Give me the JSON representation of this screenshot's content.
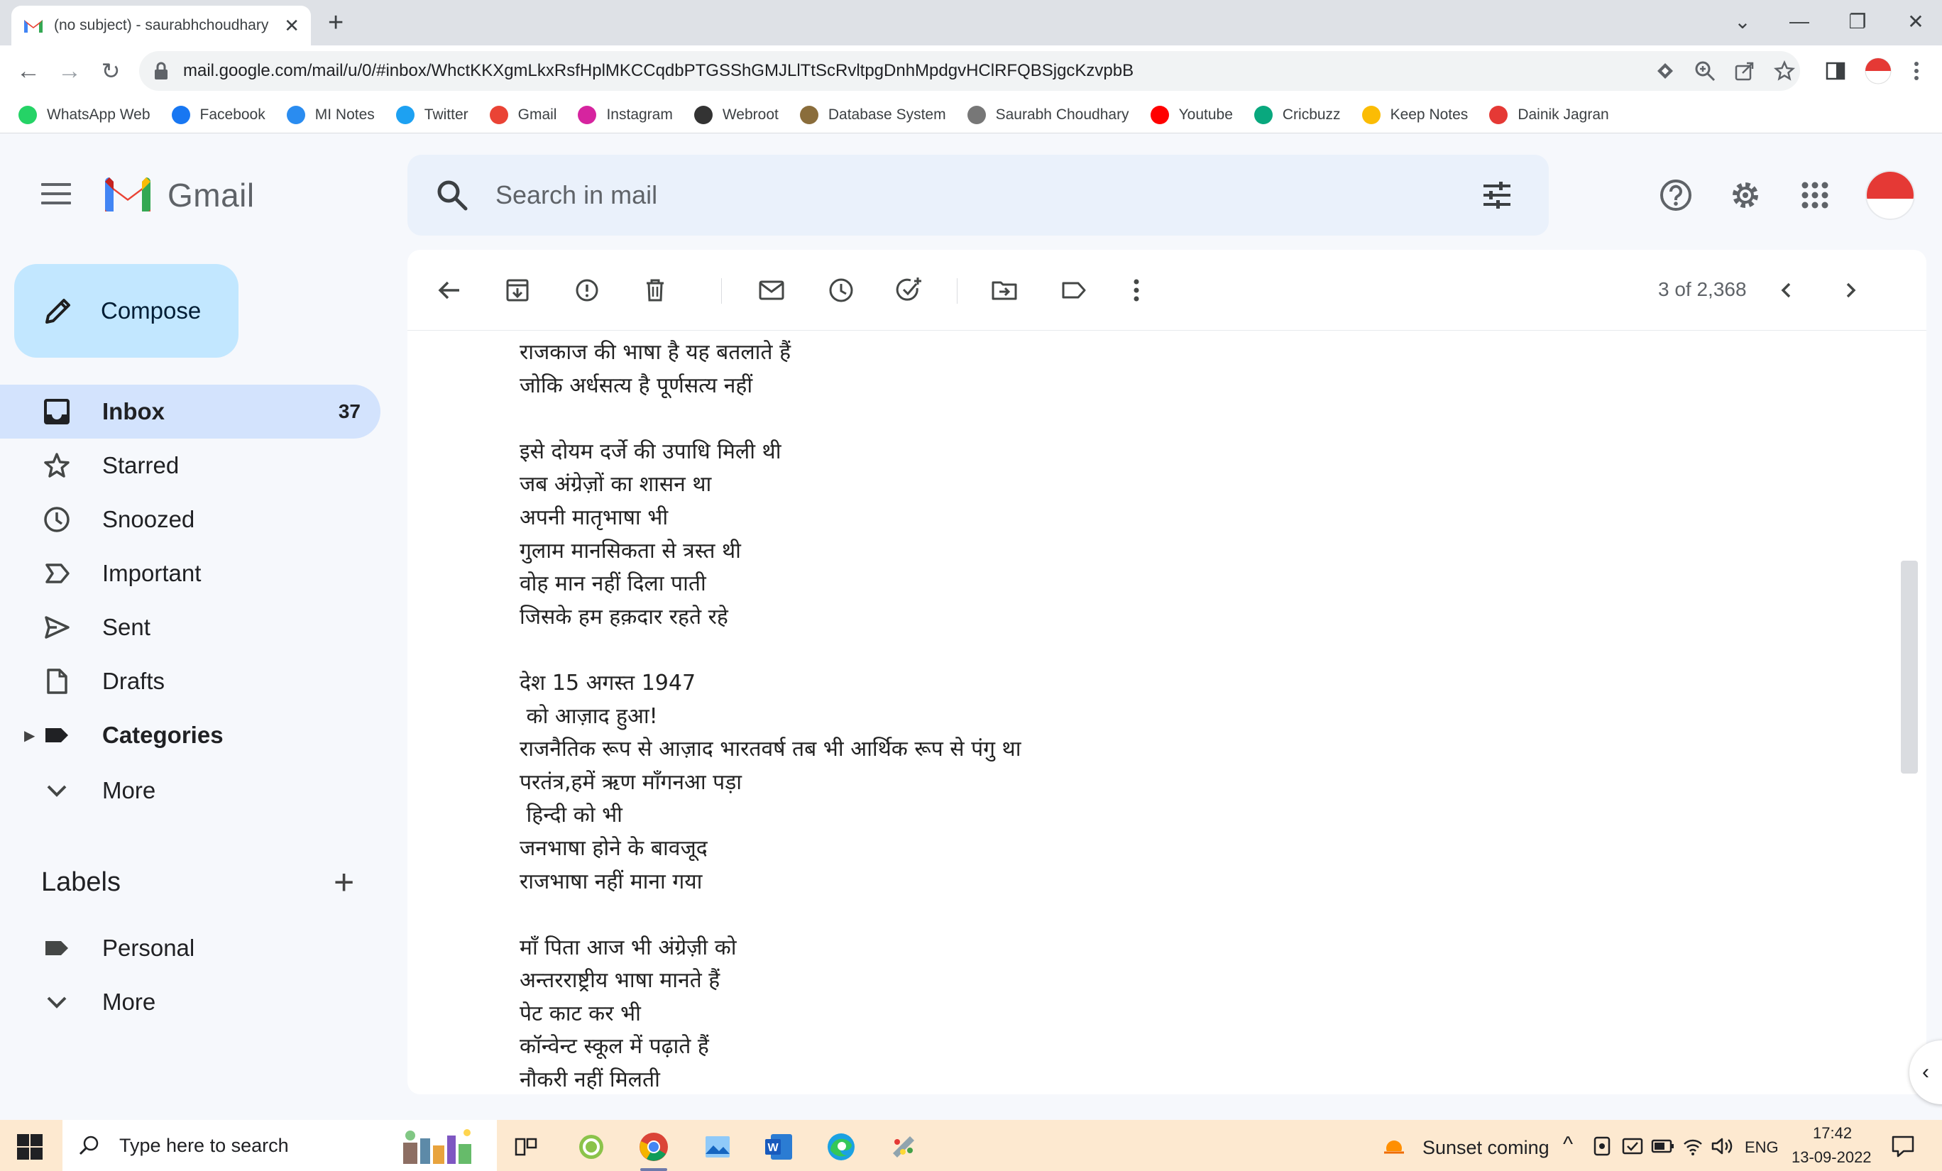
{
  "browser": {
    "tab_title": "(no subject) - saurabhchoudhary",
    "url": "mail.google.com/mail/u/0/#inbox/WhctKKXgmLkxRsfHplMKCCqdbPTGSShGMJLlTtScRvltpgDnhMpdgvHClRFQBSjgcKzvpbB"
  },
  "bookmarks": [
    {
      "label": "WhatsApp Web",
      "icon": "whatsapp-icon",
      "color": "#25d366"
    },
    {
      "label": "Facebook",
      "icon": "facebook-icon",
      "color": "#1877f2"
    },
    {
      "label": "MI Notes",
      "icon": "cloud-icon",
      "color": "#2a8cf0"
    },
    {
      "label": "Twitter",
      "icon": "twitter-icon",
      "color": "#1da1f2"
    },
    {
      "label": "Gmail",
      "icon": "gmail-icon",
      "color": "#ea4335"
    },
    {
      "label": "Instagram",
      "icon": "instagram-icon",
      "color": "#d6249f"
    },
    {
      "label": "Webroot",
      "icon": "webroot-icon",
      "color": "#333333"
    },
    {
      "label": "Database System",
      "icon": "database-icon",
      "color": "#8a6d3b"
    },
    {
      "label": "Saurabh Choudhary",
      "icon": "page-icon",
      "color": "#777777"
    },
    {
      "label": "Youtube",
      "icon": "youtube-icon",
      "color": "#ff0000"
    },
    {
      "label": "Cricbuzz",
      "icon": "cricbuzz-icon",
      "color": "#09a87e"
    },
    {
      "label": "Keep Notes",
      "icon": "keep-icon",
      "color": "#fbbc04"
    },
    {
      "label": "Dainik Jagran",
      "icon": "jagran-icon",
      "color": "#e53935"
    }
  ],
  "gmail": {
    "brand": "Gmail",
    "search_placeholder": "Search in mail",
    "compose_label": "Compose"
  },
  "sidebar": {
    "items": [
      {
        "label": "Inbox",
        "count": "37",
        "icon": "inbox-icon"
      },
      {
        "label": "Starred",
        "icon": "star-icon"
      },
      {
        "label": "Snoozed",
        "icon": "clock-icon"
      },
      {
        "label": "Important",
        "icon": "important-icon"
      },
      {
        "label": "Sent",
        "icon": "send-icon"
      },
      {
        "label": "Drafts",
        "icon": "draft-icon"
      },
      {
        "label": "Categories",
        "icon": "label-icon"
      },
      {
        "label": "More",
        "icon": "chevron-down-icon"
      }
    ],
    "labels_heading": "Labels",
    "labels": [
      {
        "label": "Personal",
        "icon": "label-icon"
      },
      {
        "label": "More",
        "icon": "chevron-down-icon"
      }
    ]
  },
  "message": {
    "pager": "3 of 2,368",
    "lines": [
      "राजकाज की भाषा है यह बतलाते हैं",
      "जोकि अर्धसत्य है पूर्णसत्य नहीं",
      "",
      "इसे दोयम दर्जे की उपाधि मिली थी",
      "जब अंग्रेज़ों का शासन था",
      "अपनी मातृभाषा भी",
      "गुलाम मानसिकता से त्रस्त थी",
      "वोह मान नहीं दिला पाती",
      "जिसके हम हक़दार रहते रहे",
      "",
      "देश 15 अगस्त 1947",
      " को आज़ाद हुआ!",
      "राजनैतिक रूप से आज़ाद भारतवर्ष तब भी आर्थिक रूप से पंगु था",
      "परतंत्र,हमें ऋण माँगनआ पड़ा",
      " हिन्दी को भी",
      "जनभाषा होने के बावजूद",
      "राजभाषा नहीं माना गया",
      "",
      "माँ पिता आज भी अंग्रेज़ी को",
      "अन्तरराष्ट्रीय भाषा मानते हैं",
      "पेट काट कर भी",
      "कॉन्वेन्ट स्कूल में पढ़ाते हैं",
      "नौकरी नहीं मिलती"
    ]
  },
  "taskbar": {
    "search_placeholder": "Type here to search",
    "weather": "Sunset coming",
    "language": "ENG",
    "time": "17:42",
    "date": "13-09-2022"
  }
}
